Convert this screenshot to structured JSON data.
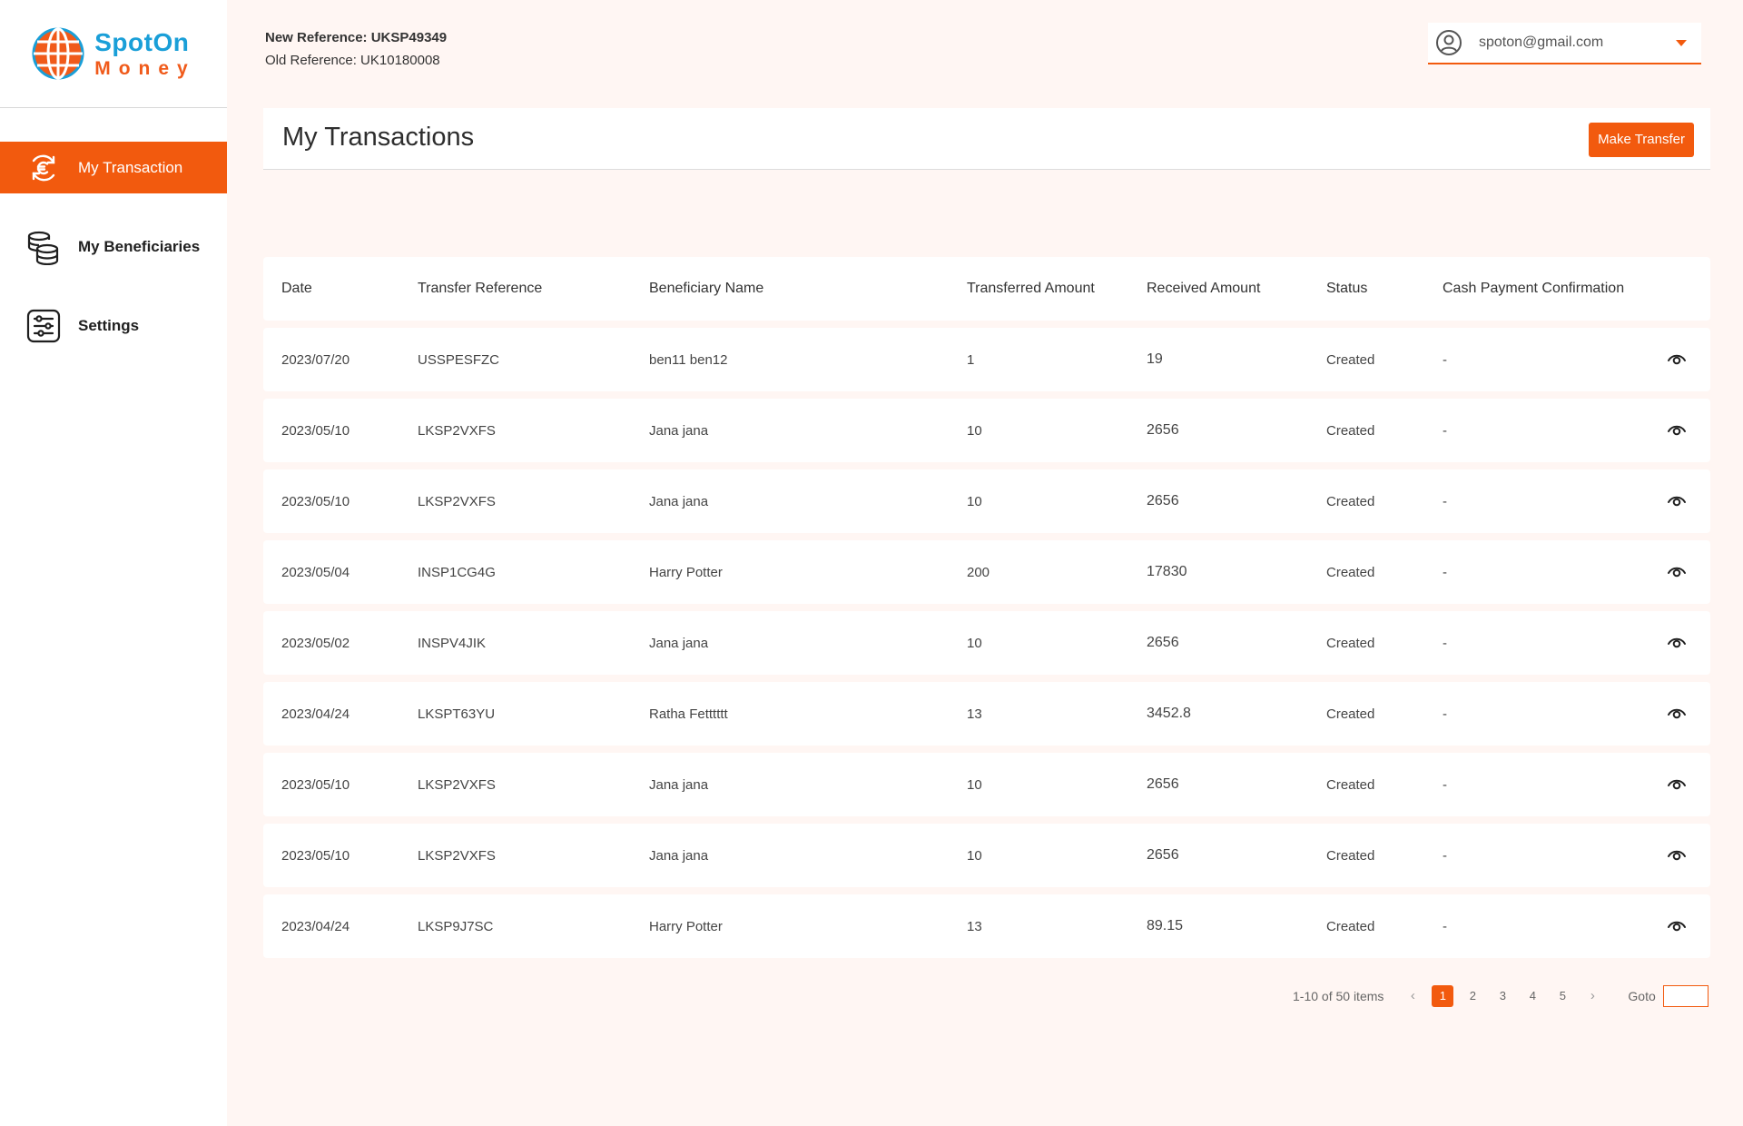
{
  "brand": {
    "name_top": "SpotOn",
    "name_bottom": "Money"
  },
  "sidebar": {
    "items": [
      {
        "label": "My Transaction",
        "icon": "euro-exchange-icon",
        "active": true
      },
      {
        "label": "My Beneficiaries",
        "icon": "coins-stack-icon",
        "active": false
      },
      {
        "label": "Settings",
        "icon": "sliders-icon",
        "active": false
      }
    ]
  },
  "header": {
    "new_reference": "New Reference: UKSP49349",
    "old_reference": "Old Reference: UK10180008",
    "user_email": "spoton@gmail.com"
  },
  "main": {
    "title": "My Transactions",
    "make_transfer_label": "Make Transfer"
  },
  "table": {
    "columns": [
      "Date",
      "Transfer Reference",
      "Beneficiary Name",
      "Transferred Amount",
      "Received Amount",
      "Status",
      "Cash Payment Confirmation"
    ],
    "rows": [
      [
        "2023/07/20",
        "USSPESFZC",
        "ben11 ben12",
        "1",
        "19",
        "Created",
        "-"
      ],
      [
        "2023/05/10",
        "LKSP2VXFS",
        "Jana jana",
        "10",
        "2656",
        "Created",
        "-"
      ],
      [
        "2023/05/10",
        "LKSP2VXFS",
        "Jana jana",
        "10",
        "2656",
        "Created",
        "-"
      ],
      [
        "2023/05/04",
        "INSP1CG4G",
        "Harry Potter",
        "200",
        "17830",
        "Created",
        "-"
      ],
      [
        "2023/05/02",
        "INSPV4JIK",
        "Jana jana",
        "10",
        "2656",
        "Created",
        "-"
      ],
      [
        "2023/04/24",
        "LKSPT63YU",
        "Ratha Fetttttt",
        "13",
        "3452.8",
        "Created",
        "-"
      ],
      [
        "2023/05/10",
        "LKSP2VXFS",
        "Jana jana",
        "10",
        "2656",
        "Created",
        "-"
      ],
      [
        "2023/05/10",
        "LKSP2VXFS",
        "Jana jana",
        "10",
        "2656",
        "Created",
        "-"
      ],
      [
        "2023/04/24",
        "LKSP9J7SC",
        "Harry Potter",
        "13",
        "89.15",
        "Created",
        "-"
      ]
    ]
  },
  "pagination": {
    "summary": "1-10 of 50 items",
    "pages": [
      "1",
      "2",
      "3",
      "4",
      "5"
    ],
    "current": "1",
    "prev": "‹",
    "next": "›",
    "goto_label": "Goto",
    "goto_value": ""
  },
  "colors": {
    "accent": "#f25a0e",
    "brand_blue": "#1a9fd8",
    "background": "#fff6f3"
  }
}
